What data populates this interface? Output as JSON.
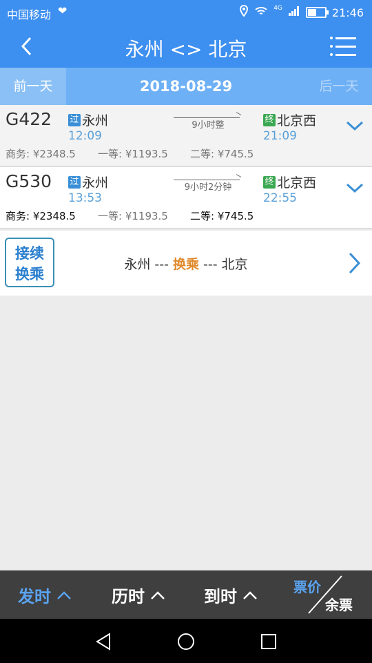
{
  "status_bar": {
    "carrier": "中国移动",
    "time": "21:46",
    "network": "4G"
  },
  "header": {
    "title": "永州 <> 北京"
  },
  "date_bar": {
    "prev_label": "前一天",
    "date": "2018-08-29",
    "next_label": "后一天"
  },
  "trains": [
    {
      "number": "G422",
      "from_tag": "过",
      "from": "永州",
      "depart": "12:09",
      "duration": "9小时整",
      "to_tag": "终",
      "to": "北京西",
      "arrive": "21:09",
      "business": "商务: ¥2348.5",
      "first": "一等: ¥1193.5",
      "second": "二等: ¥745.5"
    },
    {
      "number": "G530",
      "from_tag": "过",
      "from": "永州",
      "depart": "13:53",
      "duration": "9小时2分钟",
      "to_tag": "终",
      "to": "北京西",
      "arrive": "22:55",
      "business": "商务: ¥2348.5",
      "first": "一等: ¥1193.5",
      "second": "二等: ¥745.5"
    }
  ],
  "transfer": {
    "badge_line1": "接续",
    "badge_line2": "换乘",
    "from": "永州",
    "sep1": " --- ",
    "middle": "换乘",
    "sep2": " --- ",
    "to": "北京"
  },
  "bottom": {
    "depart_label": "发时",
    "duration_label": "历时",
    "arrive_label": "到时",
    "price_label": "票价",
    "remain_label": "余票"
  },
  "colors": {
    "primary": "#3d8ff0",
    "accent": "#e08a2c",
    "pass_tag": "#3a8fd6",
    "end_tag": "#3aa852"
  }
}
